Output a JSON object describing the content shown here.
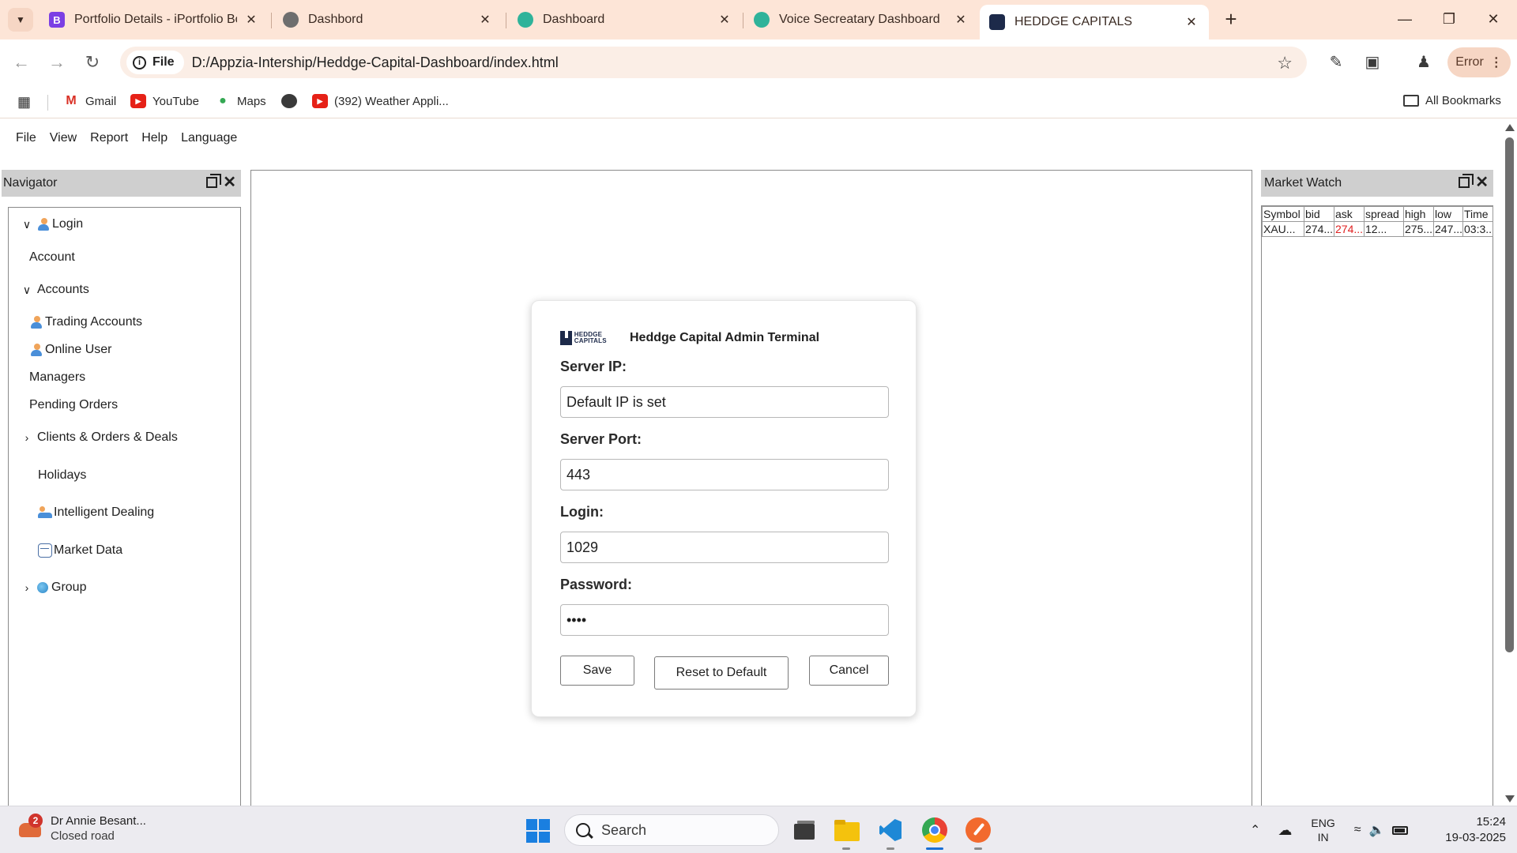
{
  "browser": {
    "tabs": [
      {
        "title": "Portfolio Details - iPortfolio Boo",
        "favicon": "B"
      },
      {
        "title": "Dashbord",
        "favicon": ""
      },
      {
        "title": "Dashboard",
        "favicon": ""
      },
      {
        "title": "Voice Secreatary Dashboard",
        "favicon": ""
      },
      {
        "title": "HEDDGE CAPITALS",
        "favicon": ""
      }
    ],
    "address": {
      "scheme_chip": "File",
      "url": "D:/Appzia-Intership/Heddge-Capital-Dashboard/index.html"
    },
    "error_label": "Error",
    "bookmarks": [
      "Gmail",
      "YouTube",
      "Maps",
      "(392) Weather Appli..."
    ],
    "all_bookmarks": "All Bookmarks",
    "colors": {
      "tab_strip": "#fde5d7",
      "omnibox": "#fbeee6"
    }
  },
  "menu": [
    "File",
    "View",
    "Report",
    "Help",
    "Language"
  ],
  "navigator": {
    "title": "Navigator",
    "items": [
      {
        "label": "Login"
      },
      {
        "label": "Account"
      },
      {
        "label": "Accounts"
      },
      {
        "label": "Trading Accounts"
      },
      {
        "label": "Online User"
      },
      {
        "label": "Managers"
      },
      {
        "label": "Pending Orders"
      },
      {
        "label": "Clients & Orders & Deals"
      },
      {
        "label": "Holidays"
      },
      {
        "label": "Intelligent Dealing"
      },
      {
        "label": "Market Data"
      },
      {
        "label": "Group"
      }
    ]
  },
  "market_watch": {
    "title": "Market Watch",
    "columns": [
      "Symbol",
      "bid",
      "ask",
      "spread",
      "high",
      "low",
      "Time"
    ],
    "rows": [
      [
        "XAU...",
        "274...",
        "274...",
        "12...",
        "275...",
        "247...",
        "03:3..."
      ]
    ],
    "ask_color": "#e02020"
  },
  "dialog": {
    "title": "Heddge Capital Admin Terminal",
    "logo_text": "HEDDGE CAPITALS",
    "fields": {
      "server_ip": {
        "label": "Server IP:",
        "value": "Default IP is set"
      },
      "server_port": {
        "label": "Server Port:",
        "value": "443"
      },
      "login": {
        "label": "Login:",
        "value": "1029"
      },
      "password": {
        "label": "Password:",
        "value": "1234"
      }
    },
    "buttons": {
      "save": "Save",
      "reset": "Reset to Default",
      "cancel": "Cancel"
    }
  },
  "taskbar": {
    "weather_badge": "2",
    "weather_title": "Dr Annie Besant...",
    "weather_sub": "Closed road",
    "search_label": "Search",
    "lang_line1": "ENG",
    "lang_line2": "IN",
    "time": "15:24",
    "date": "19-03-2025"
  }
}
